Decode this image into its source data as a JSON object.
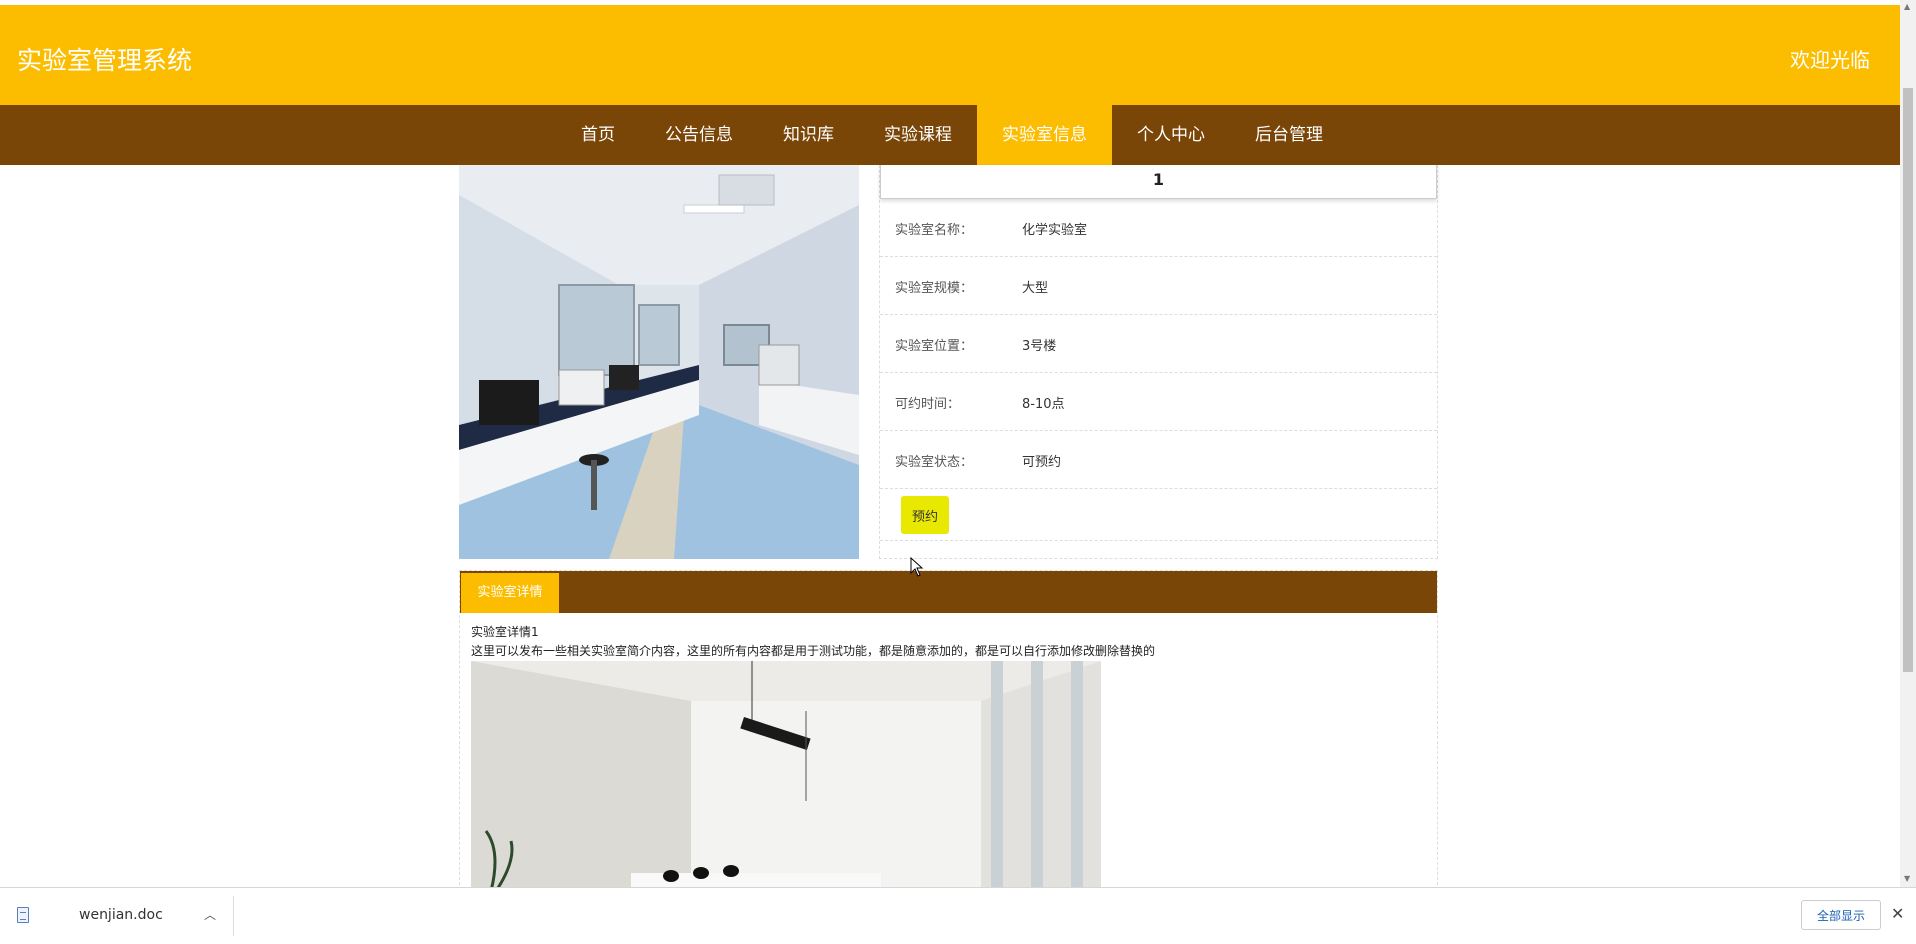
{
  "header": {
    "site_title": "实验室管理系统",
    "welcome": "欢迎光临"
  },
  "nav": {
    "items": [
      {
        "label": "首页",
        "active": false
      },
      {
        "label": "公告信息",
        "active": false
      },
      {
        "label": "知识库",
        "active": false
      },
      {
        "label": "实验课程",
        "active": false
      },
      {
        "label": "实验室信息",
        "active": true
      },
      {
        "label": "个人中心",
        "active": false
      },
      {
        "label": "后台管理",
        "active": false
      }
    ]
  },
  "lab": {
    "number": "1",
    "fields": [
      {
        "label": "实验室名称：",
        "value": "化学实验室"
      },
      {
        "label": "实验室规模：",
        "value": "大型"
      },
      {
        "label": "实验室位置：",
        "value": "3号楼"
      },
      {
        "label": "可约时间：",
        "value": "8-10点"
      },
      {
        "label": "实验室状态：",
        "value": "可预约"
      }
    ],
    "reserve_label": "预约"
  },
  "details": {
    "tab_label": "实验室详情",
    "title": "实验室详情1",
    "description": "这里可以发布一些相关实验室简介内容，这里的所有内容都是用于测试功能，都是随意添加的，都是可以自行添加修改删除替换的"
  },
  "download_bar": {
    "file_name": "wenjian.doc",
    "show_all_label": "全部显示"
  },
  "colors": {
    "header_bg": "#fcbd00",
    "nav_bg": "#7a4608",
    "reserve_btn": "#e8e800"
  }
}
